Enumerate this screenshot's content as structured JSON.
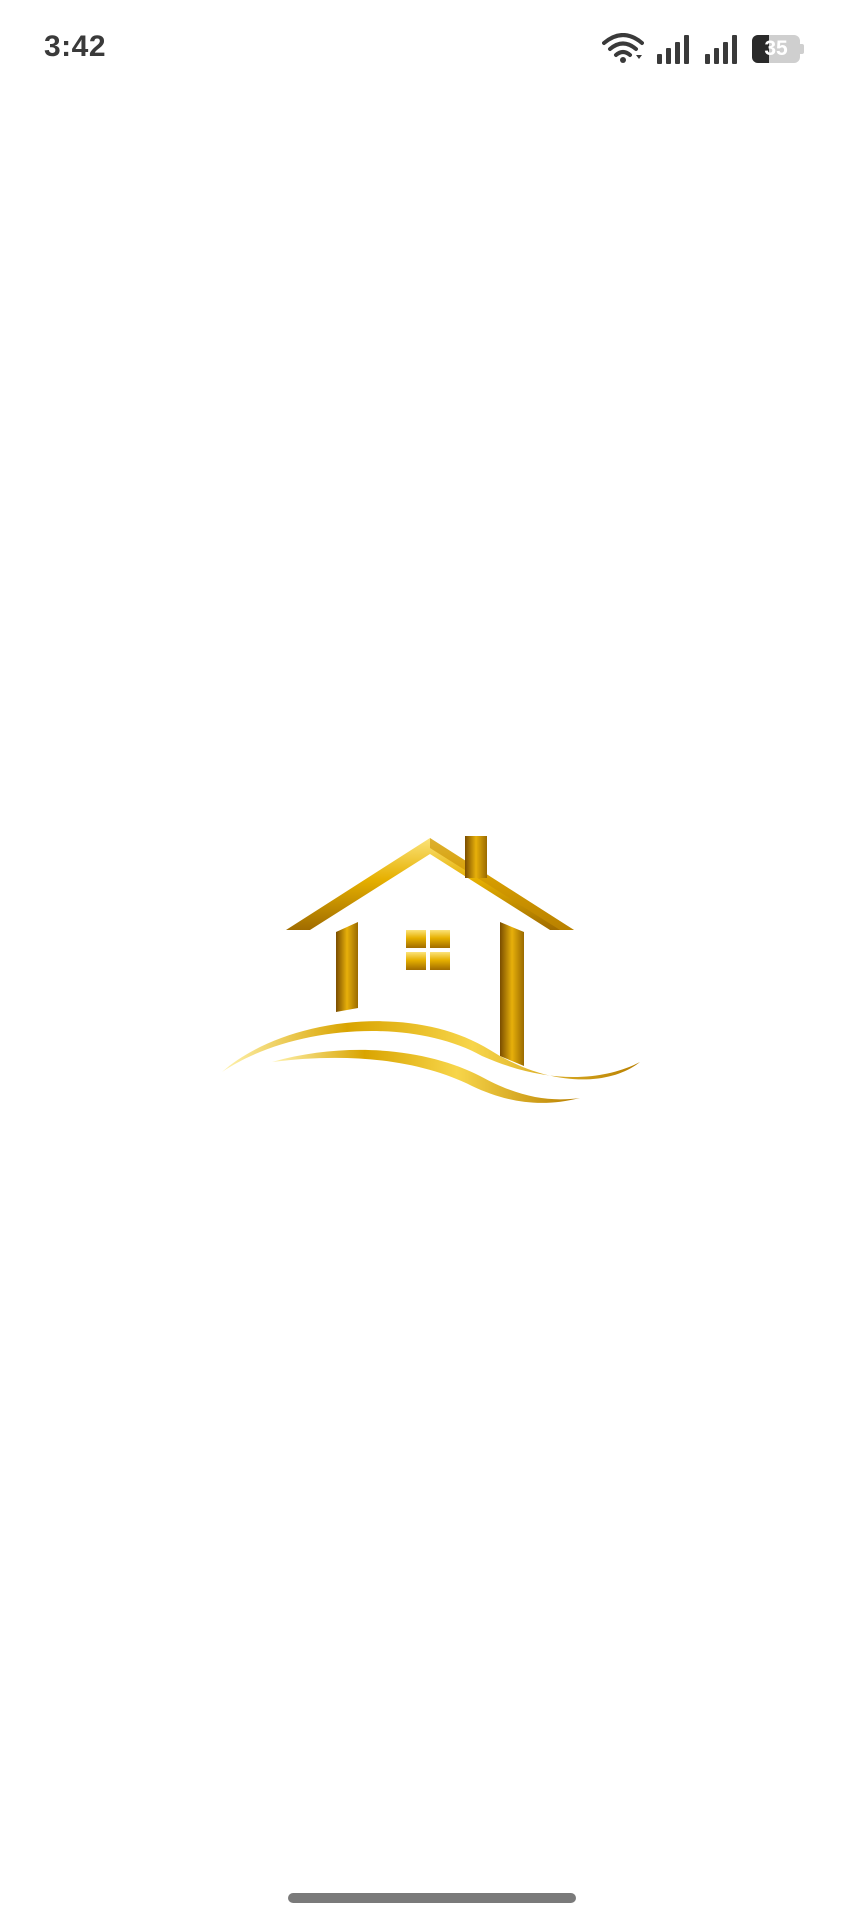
{
  "status_bar": {
    "time": "3:42",
    "battery_level": "35",
    "battery_fraction": 0.35,
    "icons": [
      "wifi-icon",
      "signal-icon",
      "signal-icon",
      "battery-icon"
    ]
  },
  "splash": {
    "logo_icon": "house-logo-icon",
    "colors": {
      "gold_light": "#f7d54a",
      "gold_mid": "#e0a800",
      "gold_dark": "#8a5a00",
      "background": "#ffffff"
    }
  }
}
